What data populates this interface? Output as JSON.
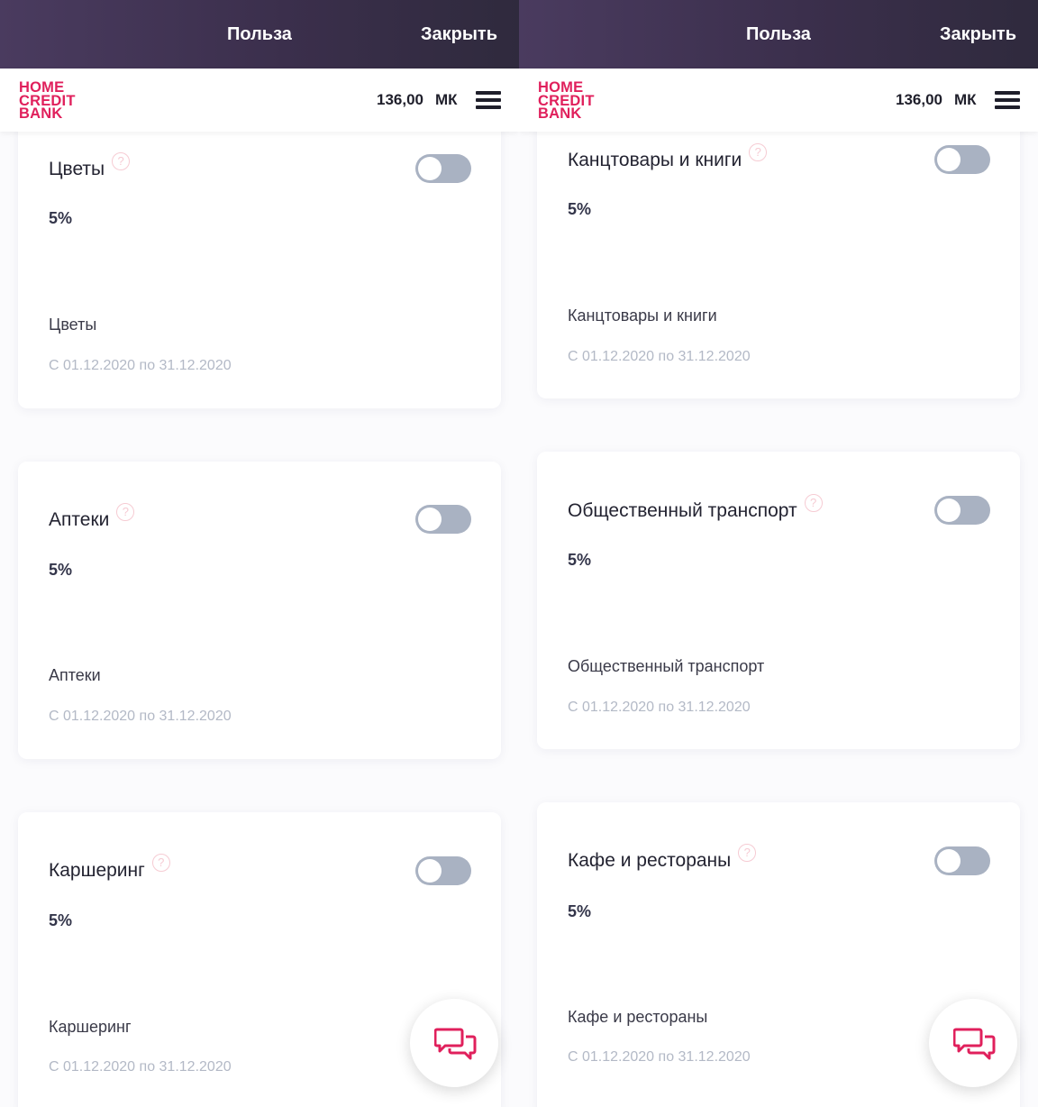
{
  "panels": [
    {
      "topbar": {
        "title": "Польза",
        "close": "Закрыть"
      },
      "header": {
        "logo": [
          "HOME",
          "CREDIT",
          "BANK"
        ],
        "balance": "136,00",
        "currency": "МК"
      },
      "cards": [
        {
          "title": "Цветы",
          "help": "?",
          "percent": "5%",
          "name": "Цветы",
          "date": "С 01.12.2020 по 31.12.2020"
        },
        {
          "title": "Аптеки",
          "help": "?",
          "percent": "5%",
          "name": "Аптеки",
          "date": "С 01.12.2020 по 31.12.2020"
        },
        {
          "title": "Каршеринг",
          "help": "?",
          "percent": "5%",
          "name": "Каршеринг",
          "date": "С 01.12.2020 по 31.12.2020"
        }
      ]
    },
    {
      "topbar": {
        "title": "Польза",
        "close": "Закрыть"
      },
      "header": {
        "logo": [
          "HOME",
          "CREDIT",
          "BANK"
        ],
        "balance": "136,00",
        "currency": "МК"
      },
      "cards": [
        {
          "title": "Канцтовары и книги",
          "help": "?",
          "percent": "5%",
          "name": "Канцтовары и книги",
          "date": "С 01.12.2020 по 31.12.2020"
        },
        {
          "title": "Общественный транспорт",
          "help": "?",
          "percent": "5%",
          "name": "Общественный транспорт",
          "date": "С 01.12.2020 по 31.12.2020"
        },
        {
          "title": "Кафе и рестораны",
          "help": "?",
          "percent": "5%",
          "name": "Кафе и рестораны",
          "date": "С 01.12.2020 по 31.12.2020"
        }
      ]
    }
  ],
  "colors": {
    "brand": "#e0205c",
    "toggle_off": "#a9b2c2",
    "topbar": "#3b2f4c"
  },
  "icons": {
    "menu": "hamburger-icon",
    "chat": "chat-bubbles-icon",
    "help": "question-icon"
  }
}
